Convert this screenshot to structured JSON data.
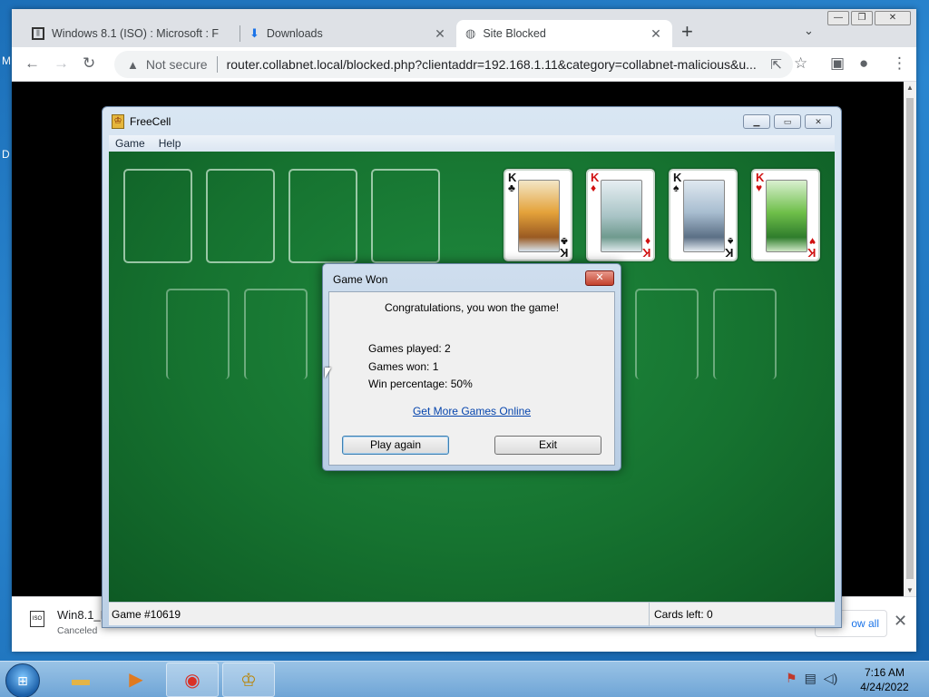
{
  "desktop": {
    "letters": [
      "M",
      "D"
    ]
  },
  "browser": {
    "tabs": [
      {
        "label": "Windows 8.1 (ISO) : Microsoft : F",
        "icon": "archive-icon"
      },
      {
        "label": "Downloads",
        "icon": "download-icon"
      },
      {
        "label": "Site Blocked",
        "icon": "globe-icon"
      }
    ],
    "security_label": "Not secure",
    "url": "router.collabnet.local/blocked.php?clientaddr=192.168.1.11&category=collabnet-malicious&u..."
  },
  "download_bar": {
    "file_name": "Win8.1_E",
    "status": "Canceled",
    "show_all": "ow all"
  },
  "freecell": {
    "title": "FreeCell",
    "menu": [
      "Game",
      "Help"
    ],
    "foundations": [
      {
        "rank": "K",
        "suit": "♣",
        "color": "black"
      },
      {
        "rank": "K",
        "suit": "♦",
        "color": "red"
      },
      {
        "rank": "K",
        "suit": "♠",
        "color": "black"
      },
      {
        "rank": "K",
        "suit": "♥",
        "color": "red"
      }
    ],
    "status_game": "Game #10619",
    "status_cards": "Cards left: 0"
  },
  "dialog": {
    "title": "Game Won",
    "congrats": "Congratulations, you won the game!",
    "games_played": "Games played: 2",
    "games_won": "Games won: 1",
    "win_percentage": "Win percentage: 50%",
    "link": "Get More Games Online",
    "play_again": "Play again",
    "exit": "Exit"
  },
  "taskbar": {
    "time": "7:16 AM",
    "date": "4/24/2022"
  }
}
